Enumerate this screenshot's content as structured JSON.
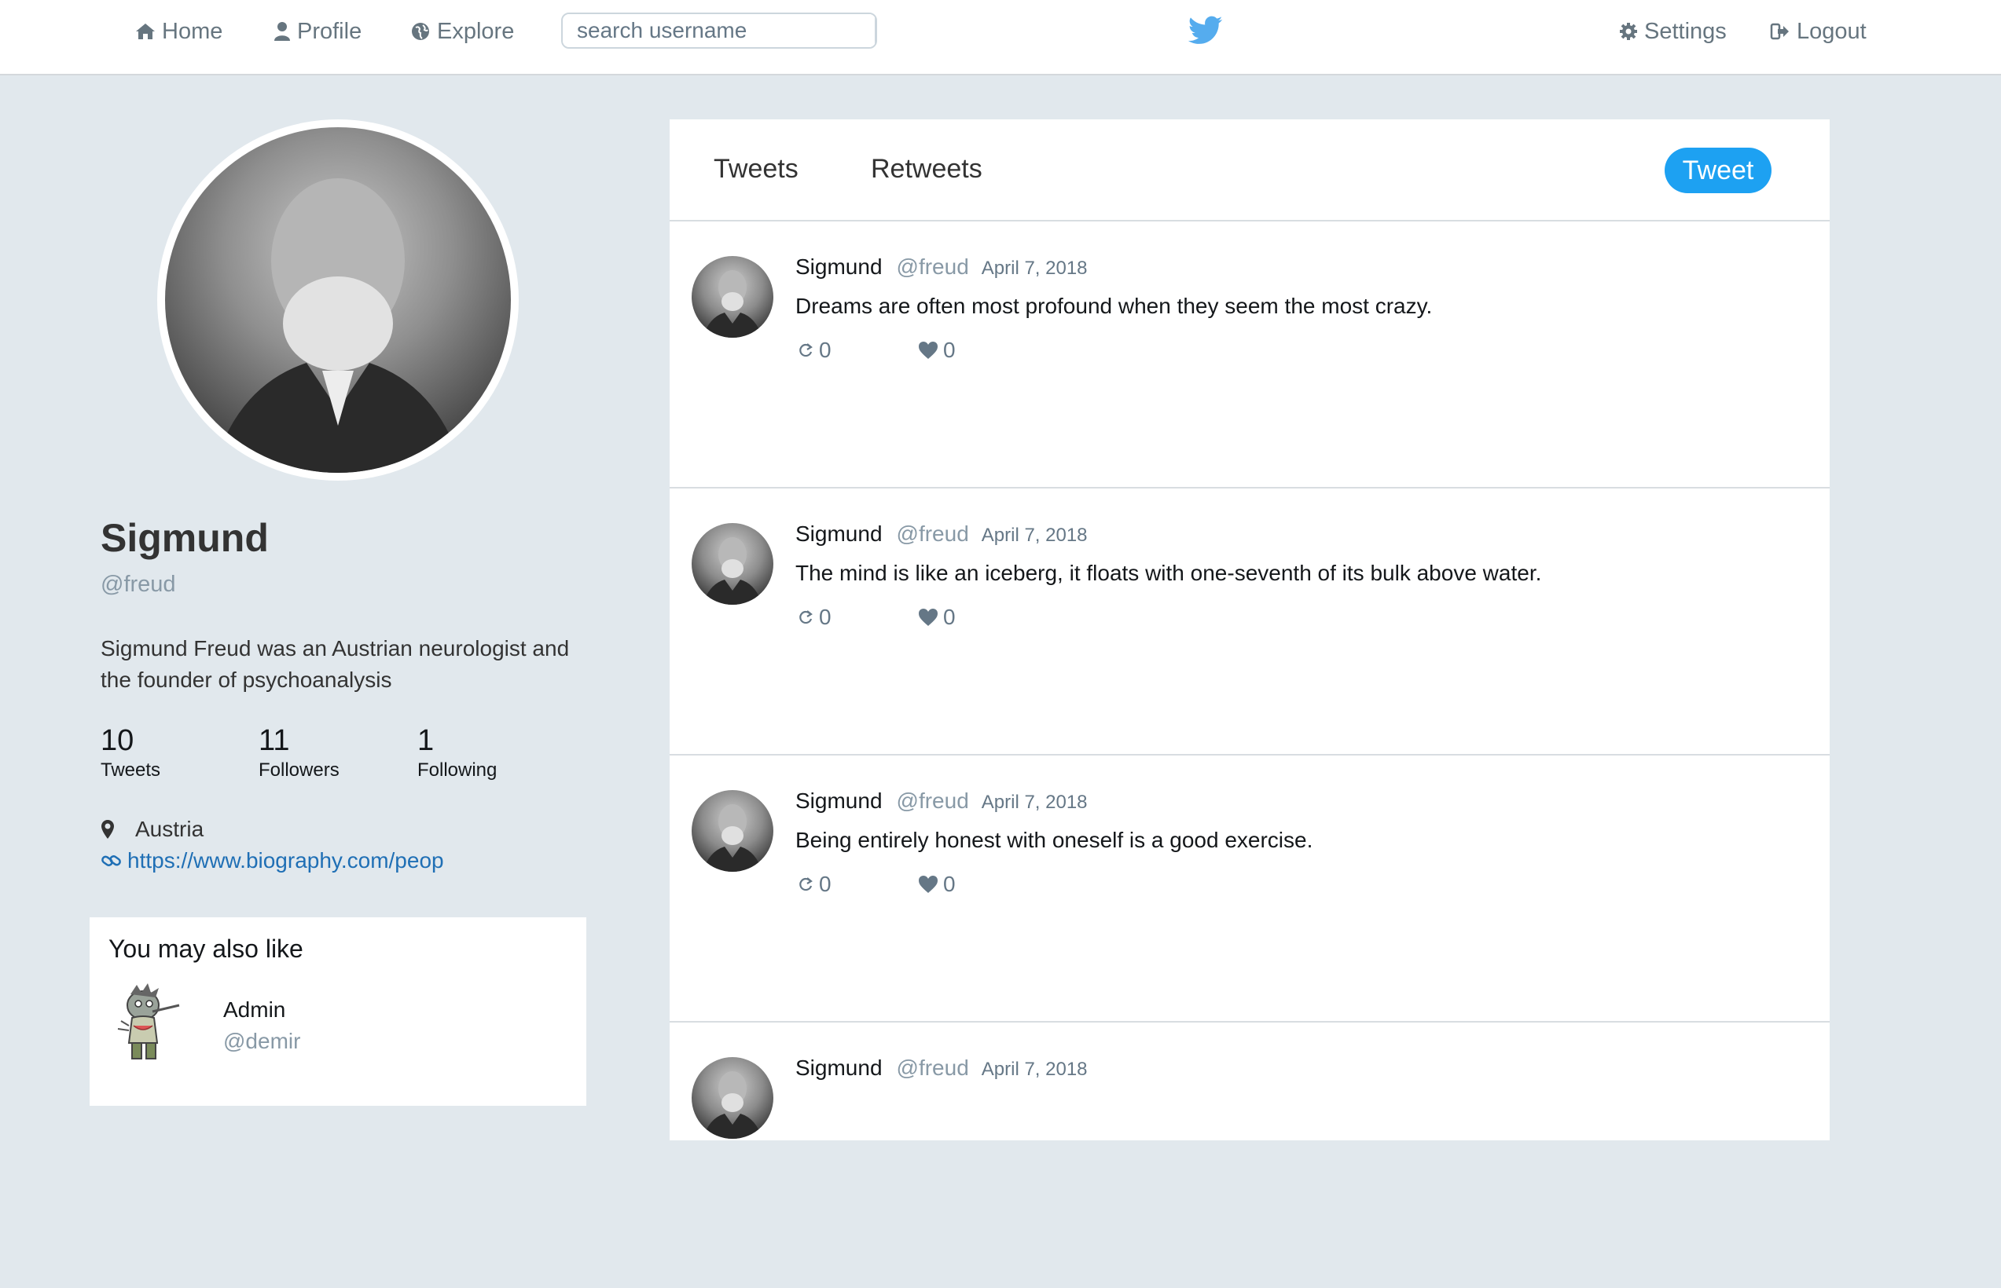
{
  "nav": {
    "home": "Home",
    "profile": "Profile",
    "explore": "Explore",
    "search_placeholder": "search username",
    "settings": "Settings",
    "logout": "Logout"
  },
  "icons": {
    "home": "home-icon",
    "profile": "user-icon",
    "explore": "globe-icon",
    "search": "search-icon",
    "brand": "twitter-bird-icon",
    "settings": "gear-icon",
    "logout": "logout-icon",
    "location": "map-marker-icon",
    "link": "link-icon",
    "retweet": "retweet-icon",
    "like": "heart-icon"
  },
  "colors": {
    "brand": "#1da1f2",
    "background": "#e1e8ed",
    "link": "#1f6fb5"
  },
  "profile": {
    "name": "Sigmund",
    "handle": "@freud",
    "bio": "Sigmund Freud was an Austrian neurologist and the founder of psychoanalysis",
    "stats": [
      {
        "value": "10",
        "label": "Tweets"
      },
      {
        "value": "11",
        "label": "Followers"
      },
      {
        "value": "1",
        "label": "Following"
      }
    ],
    "location": "Austria",
    "website": "https://www.biography.com/peop"
  },
  "suggestions": {
    "title": "You may also like",
    "users": [
      {
        "name": "Admin",
        "handle": "@demir"
      }
    ]
  },
  "feed": {
    "tabs": [
      "Tweets",
      "Retweets"
    ],
    "tweet_button": "Tweet",
    "tweets": [
      {
        "name": "Sigmund",
        "handle": "@freud",
        "date": "April 7, 2018",
        "text": "Dreams are often most profound when they seem the most crazy.",
        "retweets": "0",
        "likes": "0"
      },
      {
        "name": "Sigmund",
        "handle": "@freud",
        "date": "April 7, 2018",
        "text": "The mind is like an iceberg, it floats with one-seventh of its bulk above water.",
        "retweets": "0",
        "likes": "0"
      },
      {
        "name": "Sigmund",
        "handle": "@freud",
        "date": "April 7, 2018",
        "text": "Being entirely honest with oneself is a good exercise.",
        "retweets": "0",
        "likes": "0"
      },
      {
        "name": "Sigmund",
        "handle": "@freud",
        "date": "April 7, 2018",
        "text": "",
        "retweets": "",
        "likes": ""
      }
    ]
  }
}
